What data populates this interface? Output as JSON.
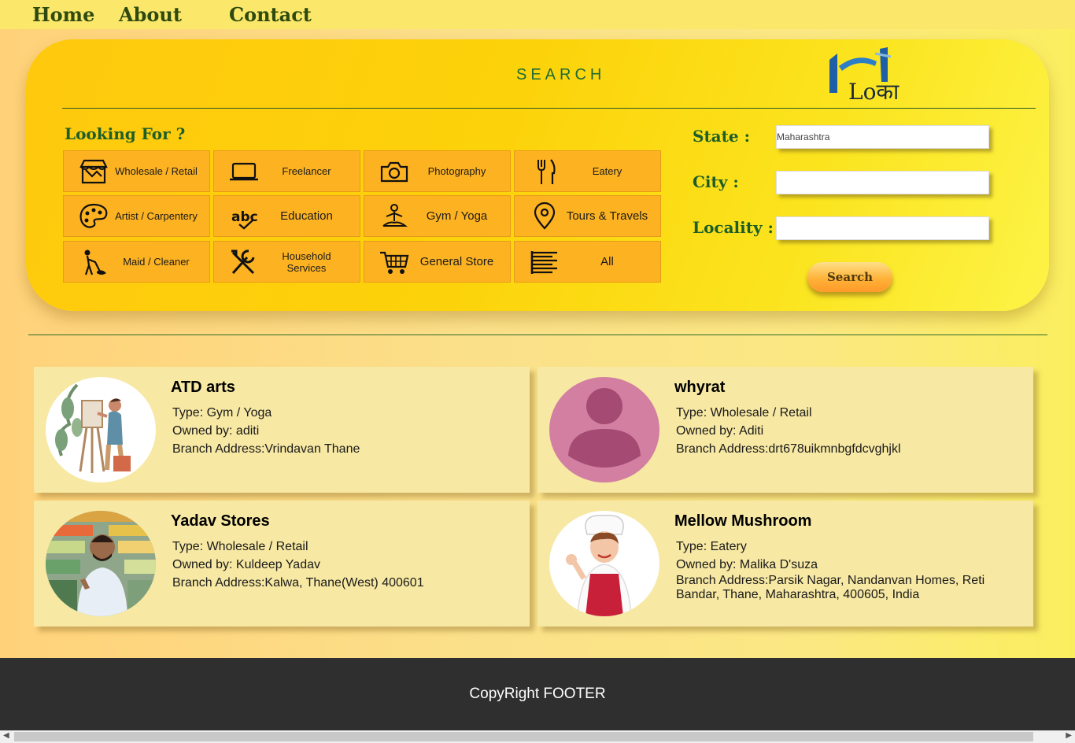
{
  "nav": {
    "home": "Home",
    "about": "About",
    "contact": "Contact"
  },
  "search": {
    "title": "SEARCH",
    "logo_text": "Loका",
    "looking_for": "Looking For ?",
    "categories": [
      {
        "label": "Wholesale / Retail",
        "icon": "shop-icon"
      },
      {
        "label": "Freelancer",
        "icon": "laptop-icon"
      },
      {
        "label": "Photography",
        "icon": "camera-icon"
      },
      {
        "label": "Eatery",
        "icon": "fork-knife-icon"
      },
      {
        "label": "Artist / Carpentery",
        "icon": "palette-icon"
      },
      {
        "label": "Education",
        "icon": "abc-icon"
      },
      {
        "label": "Gym / Yoga",
        "icon": "yoga-icon"
      },
      {
        "label": "Tours & Travels",
        "icon": "location-pin-icon"
      },
      {
        "label": "Maid / Cleaner",
        "icon": "cleaner-icon"
      },
      {
        "label": "Household Services",
        "icon": "tools-icon"
      },
      {
        "label": "General Store",
        "icon": "cart-icon"
      },
      {
        "label": "All",
        "icon": "list-icon"
      }
    ],
    "state_label": "State :",
    "city_label": "City :",
    "locality_label": "Locality :",
    "state_value": "Maharashtra",
    "city_value": "",
    "locality_value": "",
    "button": "Search"
  },
  "results": [
    {
      "name": "ATD arts",
      "type": "Type: Gym / Yoga",
      "owner": "Owned by: aditi",
      "address": "Branch Address:Vrindavan Thane",
      "avatar": "painter-avatar"
    },
    {
      "name": "whyrat",
      "type": "Type: Wholesale / Retail",
      "owner": "Owned by: Aditi",
      "address": "Branch Address:drt678uikmnbgfdcvghjkl",
      "avatar": "default-user-avatar"
    },
    {
      "name": "Yadav Stores",
      "type": "Type: Wholesale / Retail",
      "owner": "Owned by: Kuldeep Yadav",
      "address": "Branch Address:Kalwa, Thane(West) 400601",
      "avatar": "shopkeeper-avatar"
    },
    {
      "name": "Mellow Mushroom",
      "type": "Type: Eatery",
      "owner": "Owned by: Malika D'suza",
      "address": "Branch Address:Parsik Nagar, Nandanvan Homes, Reti Bandar, Thane, Maharashtra, 400605, India",
      "avatar": "chef-avatar"
    }
  ],
  "footer": "CopyRight FOOTER",
  "colors": {
    "accent_green": "#1d5e28",
    "category_orange": "#fdb221",
    "footer_bg": "#2f2f2f"
  }
}
